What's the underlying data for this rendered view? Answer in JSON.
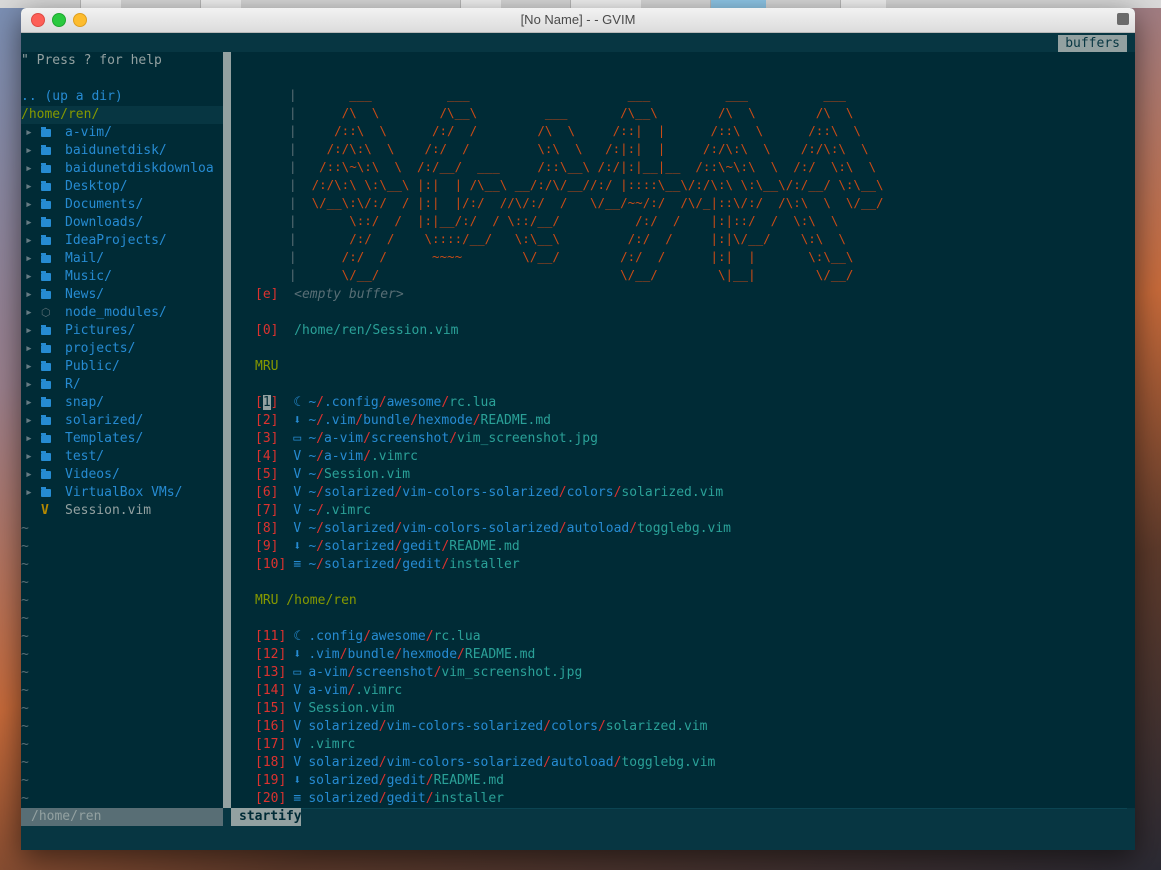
{
  "window": {
    "title": "[No Name] - - GVIM"
  },
  "tabline": {
    "buffers_label": "buffers"
  },
  "tree": {
    "help": "\" Press ? for help",
    "updir": ".. (up a dir)",
    "cwd": "/home/ren/",
    "entries": [
      {
        "name": "a-vim/",
        "kind": "dir"
      },
      {
        "name": "baidunetdisk/",
        "kind": "dir"
      },
      {
        "name": "baidunetdiskdownloa",
        "kind": "dir"
      },
      {
        "name": "Desktop/",
        "kind": "dir"
      },
      {
        "name": "Documents/",
        "kind": "dir"
      },
      {
        "name": "Downloads/",
        "kind": "dir"
      },
      {
        "name": "IdeaProjects/",
        "kind": "dir"
      },
      {
        "name": "Mail/",
        "kind": "dir"
      },
      {
        "name": "Music/",
        "kind": "dir"
      },
      {
        "name": "News/",
        "kind": "dir"
      },
      {
        "name": "node_modules/",
        "kind": "node"
      },
      {
        "name": "Pictures/",
        "kind": "dir"
      },
      {
        "name": "projects/",
        "kind": "dir"
      },
      {
        "name": "Public/",
        "kind": "dir"
      },
      {
        "name": "R/",
        "kind": "dir"
      },
      {
        "name": "snap/",
        "kind": "dir"
      },
      {
        "name": "solarized/",
        "kind": "dir"
      },
      {
        "name": "Templates/",
        "kind": "dir"
      },
      {
        "name": "test/",
        "kind": "dir"
      },
      {
        "name": "Videos/",
        "kind": "dir"
      },
      {
        "name": "VirtualBox VMs/",
        "kind": "dir"
      },
      {
        "name": "Session.vim",
        "kind": "vim"
      }
    ],
    "tilde": "~"
  },
  "startify": {
    "empty_index": "[e]",
    "empty_label": "<empty buffer>",
    "session_index": "[0]",
    "session_path": "/home/ren/Session.vim",
    "mru_title": "MRU",
    "mru": [
      {
        "idx": "[1]",
        "icon": "lua",
        "path": "~/.config/awesome/rc.lua"
      },
      {
        "idx": "[2]",
        "icon": "md",
        "path": "~/.vim/bundle/hexmode/README.md"
      },
      {
        "idx": "[3]",
        "icon": "img",
        "path": "~/a-vim/screenshot/vim_screenshot.jpg"
      },
      {
        "idx": "[4]",
        "icon": "vim",
        "path": "~/a-vim/.vimrc"
      },
      {
        "idx": "[5]",
        "icon": "vim",
        "path": "~/Session.vim"
      },
      {
        "idx": "[6]",
        "icon": "vim",
        "path": "~/solarized/vim-colors-solarized/colors/solarized.vim"
      },
      {
        "idx": "[7]",
        "icon": "vim",
        "path": "~/.vimrc"
      },
      {
        "idx": "[8]",
        "icon": "vim",
        "path": "~/solarized/vim-colors-solarized/autoload/togglebg.vim"
      },
      {
        "idx": "[9]",
        "icon": "md",
        "path": "~/solarized/gedit/README.md"
      },
      {
        "idx": "[10]",
        "icon": "txt",
        "path": "~/solarized/gedit/installer"
      }
    ],
    "mru_dir_title": "MRU /home/ren",
    "mru_dir": [
      {
        "idx": "[11]",
        "icon": "lua",
        "path": ".config/awesome/rc.lua"
      },
      {
        "idx": "[12]",
        "icon": "md",
        "path": ".vim/bundle/hexmode/README.md"
      },
      {
        "idx": "[13]",
        "icon": "img",
        "path": "a-vim/screenshot/vim_screenshot.jpg"
      },
      {
        "idx": "[14]",
        "icon": "vim",
        "path": "a-vim/.vimrc"
      },
      {
        "idx": "[15]",
        "icon": "vim",
        "path": "Session.vim"
      },
      {
        "idx": "[16]",
        "icon": "vim",
        "path": "solarized/vim-colors-solarized/colors/solarized.vim"
      },
      {
        "idx": "[17]",
        "icon": "vim",
        "path": ".vimrc"
      },
      {
        "idx": "[18]",
        "icon": "vim",
        "path": "solarized/vim-colors-solarized/autoload/togglebg.vim"
      },
      {
        "idx": "[19]",
        "icon": "md",
        "path": "solarized/gedit/README.md"
      },
      {
        "idx": "[20]",
        "icon": "txt",
        "path": "solarized/gedit/installer"
      }
    ]
  },
  "statusline": {
    "left": "/home/ren",
    "mode": "startify"
  },
  "icon_glyphs": {
    "lua": "☾",
    "md": "⬇",
    "img": "▭",
    "vim": "V",
    "txt": "≡"
  },
  "colors": {
    "base03": "#002b36",
    "base02": "#073642",
    "blue": "#268bd2",
    "red": "#dc322f",
    "green": "#859900",
    "orange": "#cb4b16",
    "cyan": "#2aa198"
  }
}
